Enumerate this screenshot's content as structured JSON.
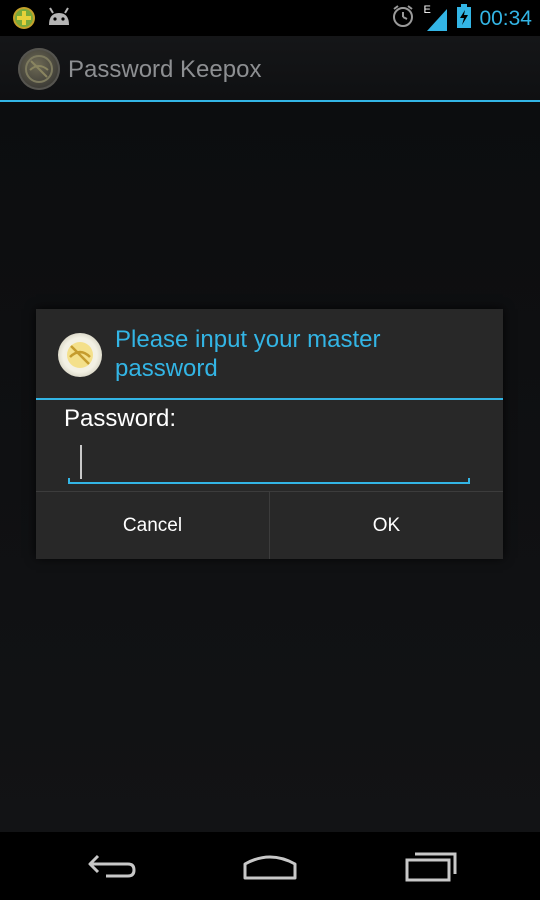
{
  "status_bar": {
    "time": "00:34",
    "network_type": "E",
    "icons": [
      "app-notification-icon",
      "android-debug-icon",
      "alarm-clock-icon",
      "signal-icon",
      "battery-charging-icon"
    ]
  },
  "action_bar": {
    "title": "Password Keepox",
    "icon": "app-logo-icon"
  },
  "dialog": {
    "title": "Please input your master password",
    "icon": "app-logo-icon",
    "label": "Password:",
    "input_value": "",
    "buttons": {
      "cancel": "Cancel",
      "ok": "OK"
    }
  },
  "nav_bar": {
    "icons": [
      "back-icon",
      "home-icon",
      "recent-apps-icon"
    ]
  },
  "colors": {
    "accent": "#33b5e5",
    "dialog_bg": "#282828",
    "background": "#000000"
  }
}
